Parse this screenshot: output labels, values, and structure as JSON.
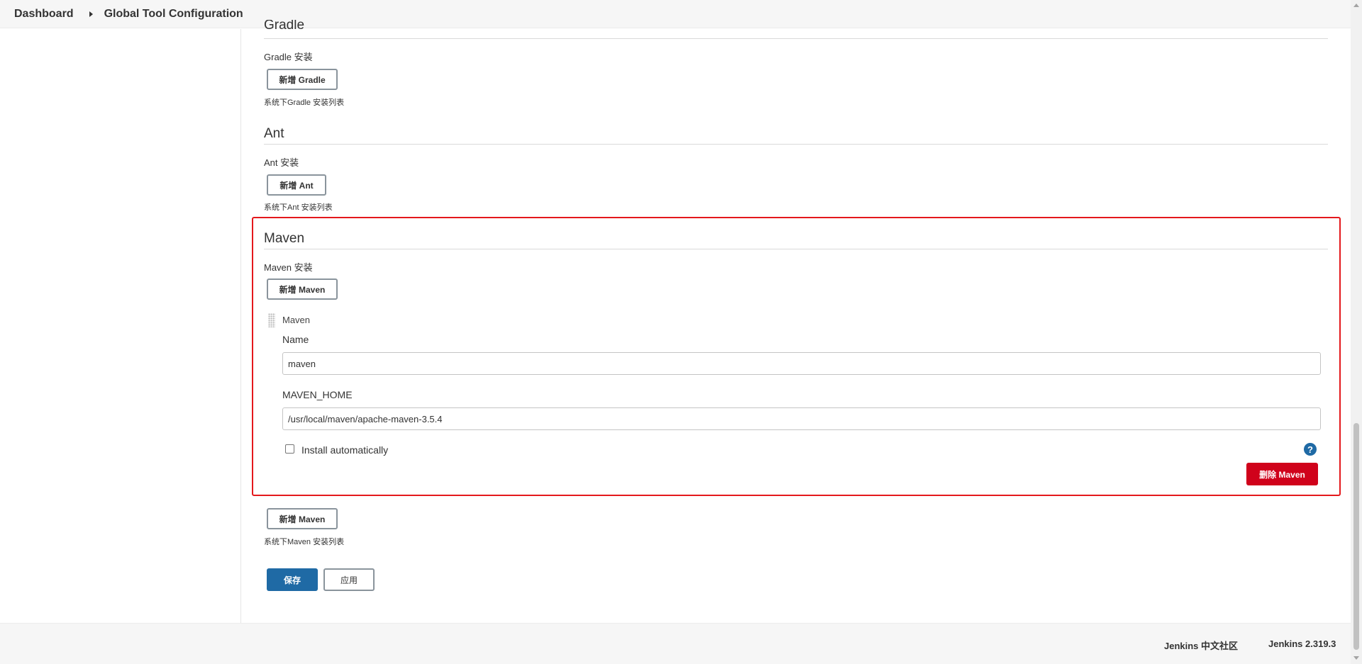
{
  "breadcrumb": {
    "items": [
      "Dashboard",
      "Global Tool Configuration"
    ]
  },
  "gradle": {
    "title": "Gradle",
    "install_label": "Gradle 安装",
    "add_button": "新增 Gradle",
    "desc": "系统下Gradle 安装列表"
  },
  "ant": {
    "title": "Ant",
    "install_label": "Ant 安装",
    "add_button": "新增 Ant",
    "desc": "系统下Ant 安装列表"
  },
  "maven": {
    "title": "Maven",
    "install_label": "Maven 安装",
    "add_button": "新增 Maven",
    "entry_title": "Maven",
    "name_label": "Name",
    "name_value": "maven",
    "home_label": "MAVEN_HOME",
    "home_value": "/usr/local/maven/apache-maven-3.5.4",
    "install_auto_label": "Install automatically",
    "install_auto_checked": false,
    "help_icon": "?",
    "delete_button": "删除 Maven",
    "add_button_bottom": "新增 Maven",
    "desc": "系统下Maven 安装列表"
  },
  "actions": {
    "save": "保存",
    "apply": "应用"
  },
  "footer": {
    "community": "Jenkins 中文社区",
    "version": "Jenkins 2.319.3"
  },
  "colors": {
    "primary": "#1f6aa5",
    "danger": "#d0021b",
    "highlight": "#e4181c"
  }
}
